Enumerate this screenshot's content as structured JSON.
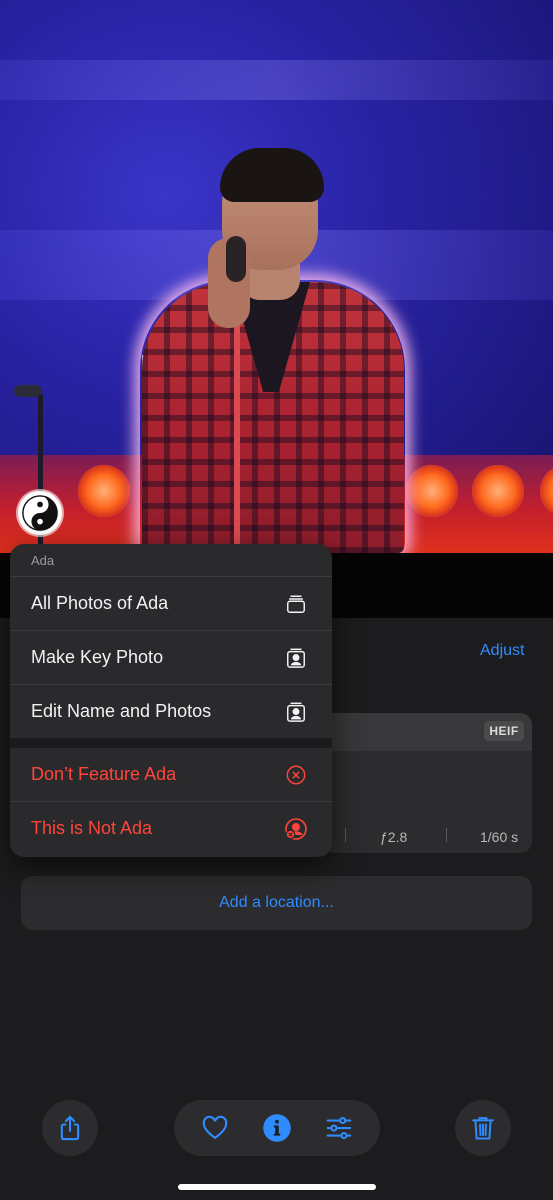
{
  "photo": {
    "face_chip_icon": "yin-yang-icon"
  },
  "context_menu": {
    "header": "Ada",
    "items": [
      {
        "label": "All Photos of Ada",
        "icon": "stack-photos-icon",
        "destructive": false
      },
      {
        "label": "Make Key Photo",
        "icon": "person-crop-rectangle-icon",
        "destructive": false
      },
      {
        "label": "Edit Name and Photos",
        "icon": "person-crop-rectangle-icon",
        "destructive": false
      }
    ],
    "destructive_items": [
      {
        "label": "Don’t Feature Ada",
        "icon": "x-circle-icon",
        "destructive": true
      },
      {
        "label": "This is Not Ada",
        "icon": "person-x-circle-icon",
        "destructive": true
      }
    ]
  },
  "info": {
    "adjust_label": "Adjust",
    "format_badge": "HEIF",
    "aperture": "ƒ2.8",
    "shutter": "1/60 s",
    "location_placeholder": "Add a location..."
  },
  "toolbar": {
    "share": "share-icon",
    "favorite": "heart-icon",
    "info": "info-icon",
    "edit": "sliders-icon",
    "delete": "trash-icon"
  },
  "colors": {
    "accent": "#2f8cff",
    "destructive": "#ff453a",
    "panel_bg": "#1c1c1e",
    "card_bg": "#2c2c2e"
  }
}
